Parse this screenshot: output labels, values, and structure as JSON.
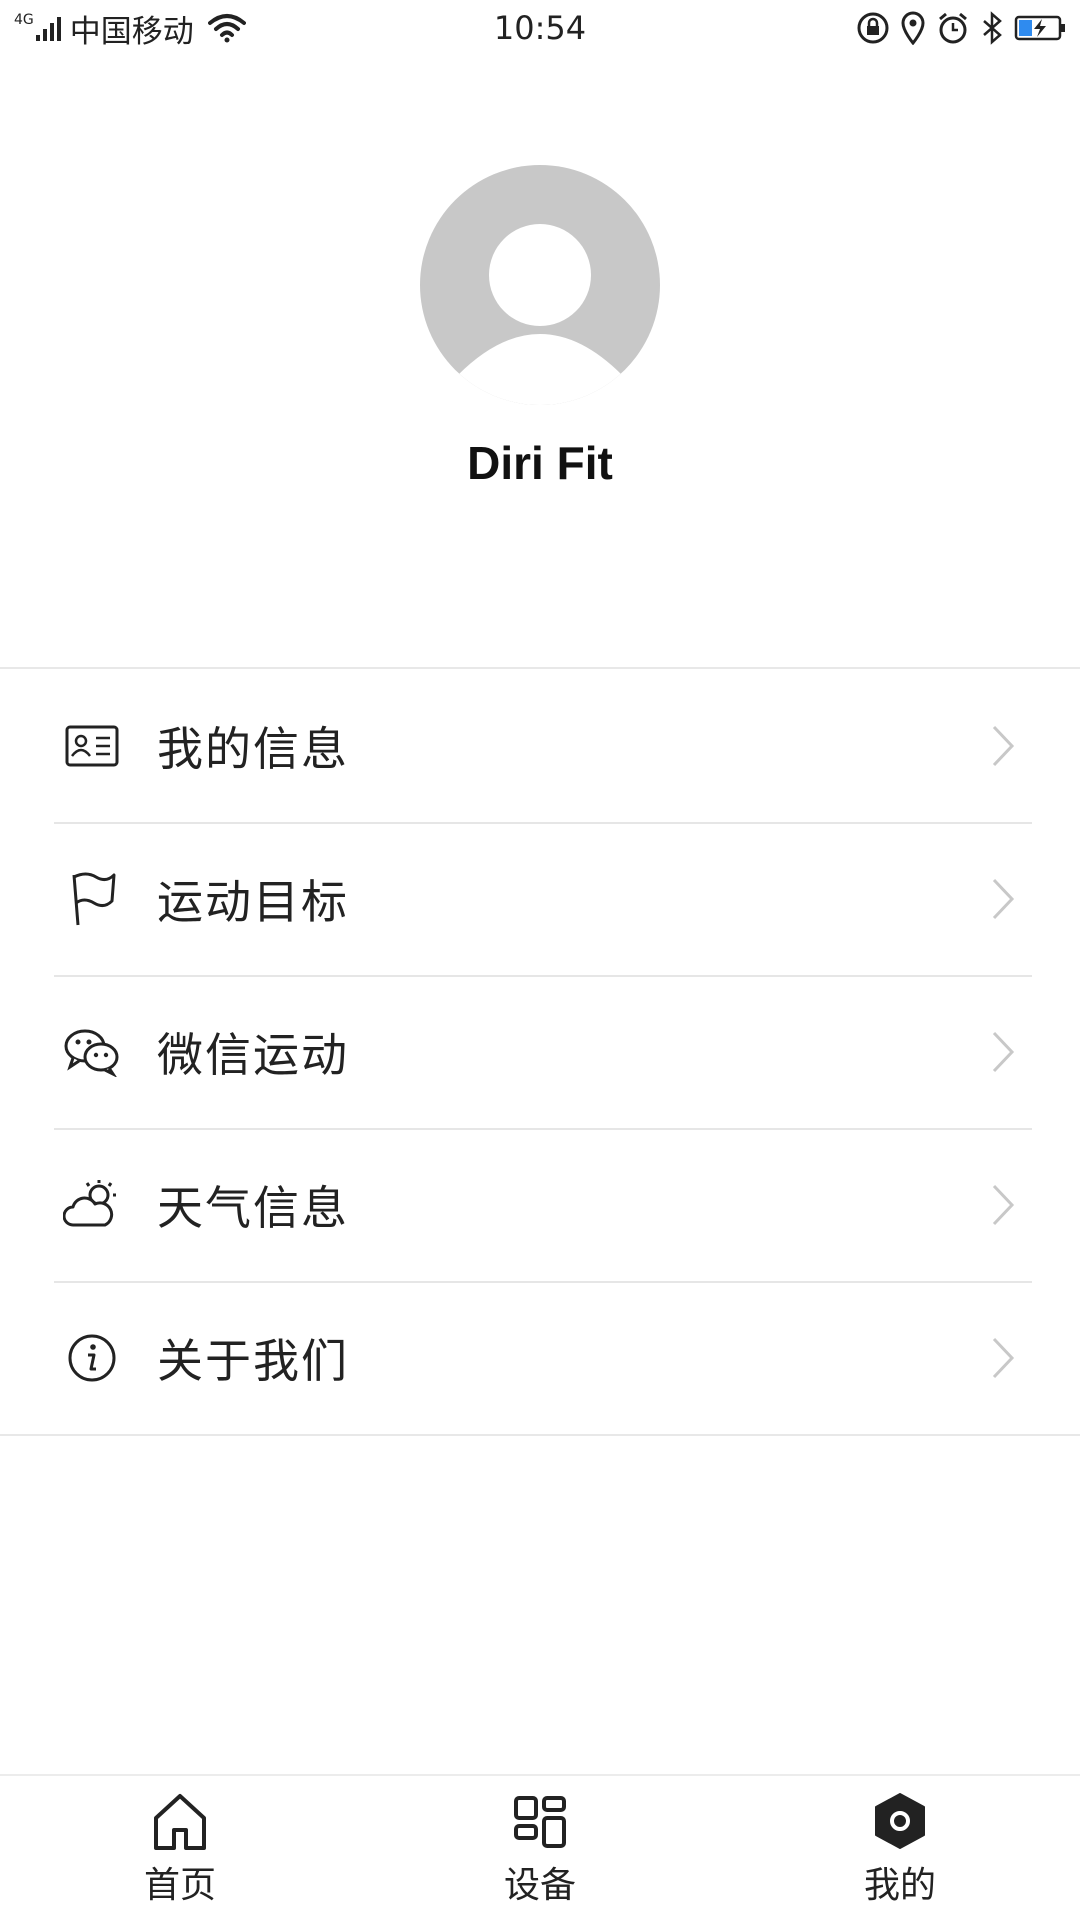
{
  "status_bar": {
    "network": "4G",
    "carrier": "中国移动",
    "time": "10:54"
  },
  "profile": {
    "username": "Diri Fit"
  },
  "menu": {
    "items": [
      {
        "label": "我的信息",
        "icon": "id-card-icon"
      },
      {
        "label": "运动目标",
        "icon": "flag-icon"
      },
      {
        "label": "微信运动",
        "icon": "wechat-icon"
      },
      {
        "label": "天气信息",
        "icon": "weather-icon"
      },
      {
        "label": "关于我们",
        "icon": "info-icon"
      }
    ]
  },
  "tabbar": {
    "tabs": [
      {
        "label": "首页",
        "icon": "home-icon",
        "active": false
      },
      {
        "label": "设备",
        "icon": "devices-icon",
        "active": false
      },
      {
        "label": "我的",
        "icon": "profile-hexagon-icon",
        "active": true
      }
    ]
  },
  "colors": {
    "avatar_gray": "#c8c8c8",
    "battery_blue": "#2f8bef",
    "divider": "#e6e6e6"
  }
}
